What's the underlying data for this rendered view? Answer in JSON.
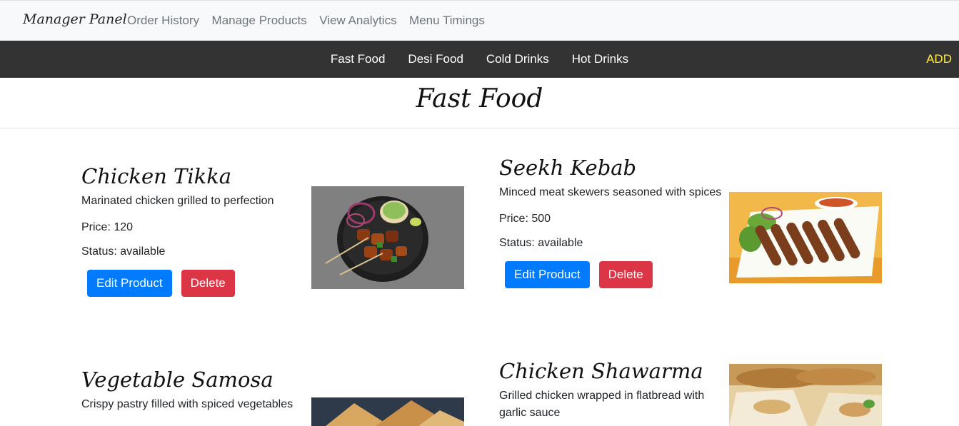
{
  "navbar": {
    "brand": "Manager Panel",
    "links": [
      "Order History",
      "Manage Products",
      "View Analytics",
      "Menu Timings"
    ]
  },
  "categories": {
    "items": [
      "Fast Food",
      "Desi Food",
      "Cold Drinks",
      "Hot Drinks"
    ],
    "add_label": "ADD"
  },
  "section": {
    "title": "Fast Food"
  },
  "buttons": {
    "edit_label": "Edit Product",
    "delete_label": "Delete"
  },
  "products": [
    {
      "name": "Chicken Tikka",
      "description": "Marinated chicken grilled to perfection",
      "price": "Price: 120",
      "status": "Status: available",
      "image": "chicken-tikka-photo"
    },
    {
      "name": "Seekh Kebab",
      "description": "Minced meat skewers seasoned with spices",
      "price": "Price: 500",
      "status": "Status: available",
      "image": "seekh-kebab-photo"
    },
    {
      "name": "Vegetable Samosa",
      "description": "Crispy pastry filled with spiced vegetables",
      "image": "vegetable-samosa-photo"
    },
    {
      "name": "Chicken Shawarma",
      "description": "Grilled chicken wrapped in flatbread with garlic sauce",
      "image": "chicken-shawarma-photo"
    }
  ],
  "colors": {
    "navbar_bg": "#f8f9fa",
    "category_bar_bg": "#333333",
    "add_link": "#ffeb3b",
    "edit_button": "#007bff",
    "delete_button": "#dc3545"
  }
}
